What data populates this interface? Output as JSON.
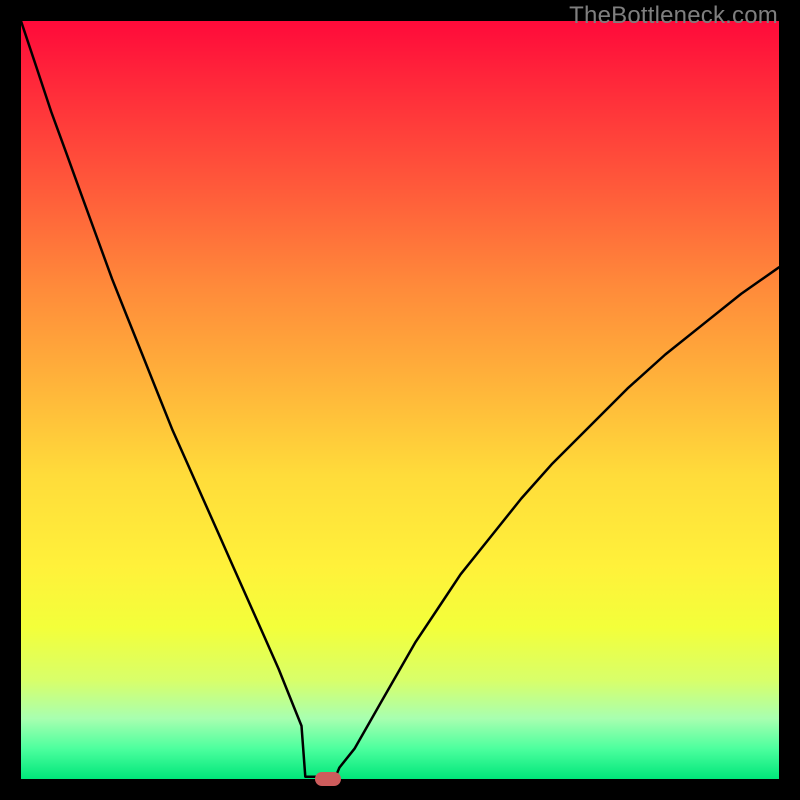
{
  "watermark": "TheBottleneck.com",
  "colors": {
    "frame": "#000000",
    "curve": "#000000",
    "marker": "#cd5c5c",
    "watermark_text": "#7f7f7f"
  },
  "chart_data": {
    "type": "line",
    "title": "",
    "xlabel": "",
    "ylabel": "",
    "xlim": [
      0,
      100
    ],
    "ylim": [
      0,
      100
    ],
    "grid": false,
    "x": [
      0,
      2,
      4,
      6,
      8,
      10,
      12,
      14,
      16,
      18,
      20,
      22,
      24,
      26,
      28,
      30,
      32,
      34,
      36,
      37,
      38,
      39,
      40,
      41,
      42,
      44,
      46,
      48,
      50,
      52,
      55,
      58,
      62,
      66,
      70,
      75,
      80,
      85,
      90,
      95,
      100
    ],
    "values": [
      100,
      94,
      88,
      82.5,
      77,
      71.5,
      66,
      61,
      56,
      51,
      46,
      41.5,
      37,
      32.5,
      28,
      23.5,
      19,
      14.5,
      9.5,
      7,
      4.5,
      2.5,
      1,
      0.5,
      1.5,
      4,
      7.5,
      11,
      14.5,
      18,
      22.5,
      27,
      32,
      37,
      41.5,
      46.5,
      51.5,
      56,
      60,
      64,
      67.5
    ],
    "marker": {
      "x": 40.5,
      "y": 0
    },
    "flat_bottom": {
      "x_start": 37.5,
      "x_end": 41.5,
      "y": 0.3
    }
  }
}
